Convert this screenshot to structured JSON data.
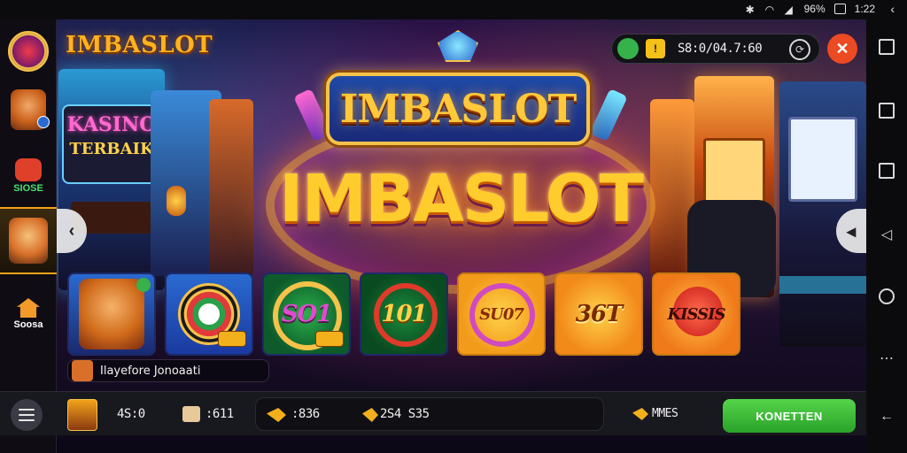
{
  "status_bar": {
    "battery_text": "96%",
    "time": "1:22"
  },
  "brand": {
    "logo_text": "IMBASLOT"
  },
  "sidebar": {
    "items": [
      {
        "name": "home-logo",
        "label": ""
      },
      {
        "name": "lion-avatar",
        "label": ""
      },
      {
        "name": "hot-games",
        "label": "SIOSE"
      },
      {
        "name": "tiger-active",
        "label": ""
      },
      {
        "name": "home",
        "label": "Soosa"
      }
    ]
  },
  "wallet": {
    "balance": "S8:0/04.7:60"
  },
  "scene": {
    "sign_left_top": "KASINO",
    "sign_left_bottom": "TERBAIK",
    "title_top": "IMBASLOT",
    "title_big": "IMBASLOT"
  },
  "tiles": [
    {
      "label": "",
      "style": "lion"
    },
    {
      "label": "",
      "style": "roulette"
    },
    {
      "label": "SO1",
      "style": "green"
    },
    {
      "label": "101",
      "style": "green2"
    },
    {
      "label": "SU07",
      "style": "orange"
    },
    {
      "label": "36T",
      "style": "orange2"
    },
    {
      "label": "KISSIS",
      "style": "orange3"
    }
  ],
  "marquee": {
    "text": "Ilayefore Jonoaati"
  },
  "bottom_bar": {
    "level": "4S:0",
    "coins": ":611",
    "stat1": ":836",
    "stat2": "2S4 S35",
    "mores": "MMES",
    "login_label": "KONETTEN"
  },
  "colors": {
    "accent_gold": "#ffcc2e",
    "login_green": "#3bbd3a",
    "close_red": "#ec4a22"
  }
}
